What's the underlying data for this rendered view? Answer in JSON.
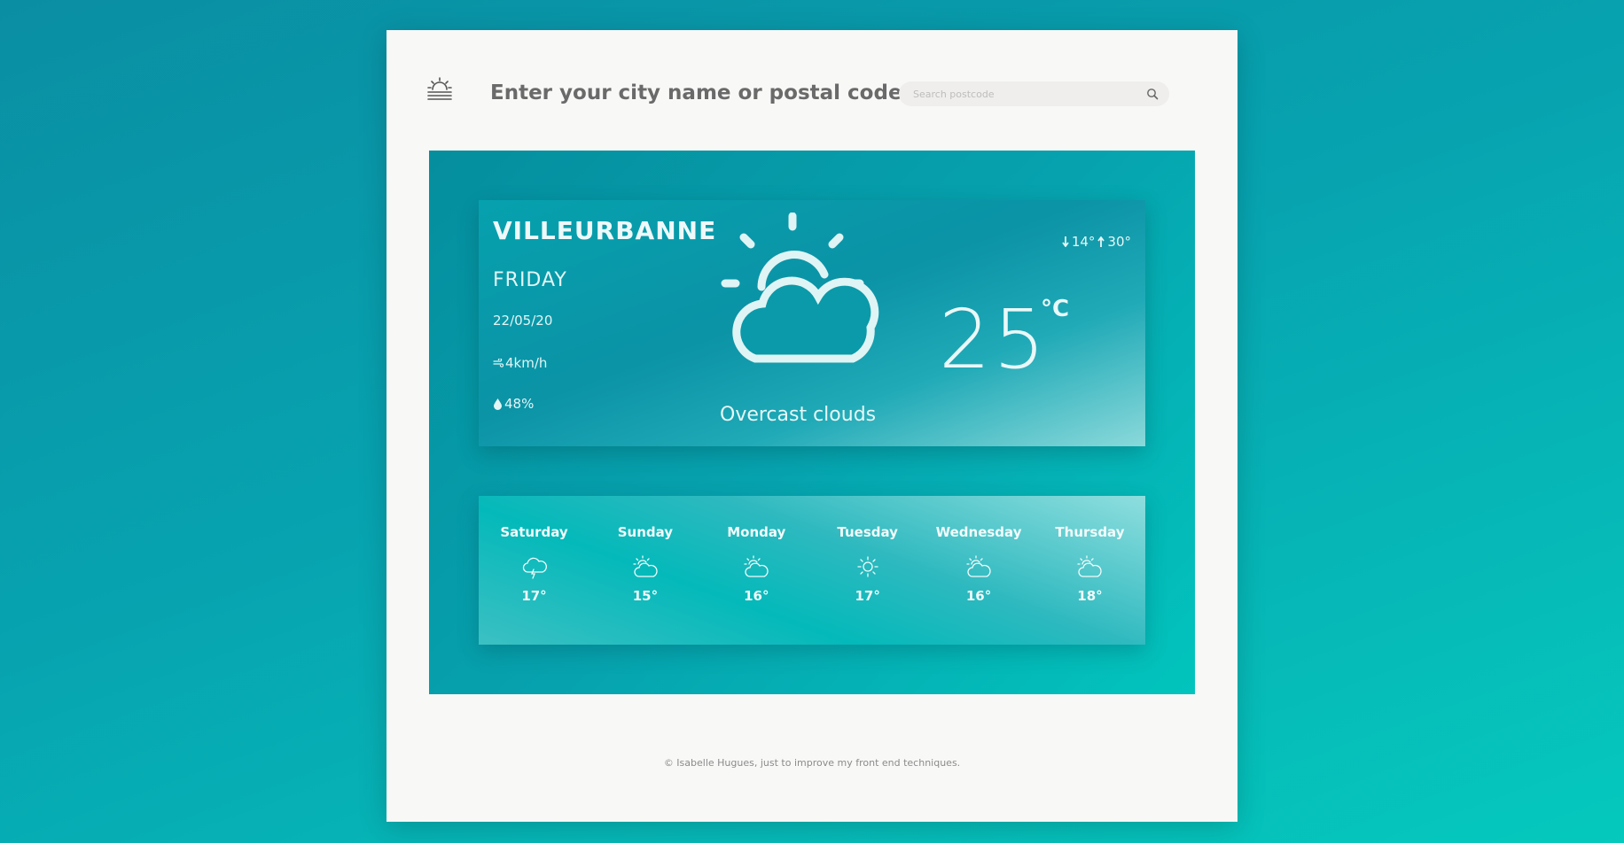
{
  "header": {
    "title": "Enter your city name or postal code",
    "search_placeholder": "Search postcode",
    "search_value": ""
  },
  "current": {
    "city": "VILLEURBANNE",
    "day": "FRIDAY",
    "date": "22/05/20",
    "wind": "4km/h",
    "humidity": "48%",
    "description": "Overcast clouds",
    "temperature": "25",
    "unit": "°C",
    "min": "14°",
    "max": "30°",
    "icon": "cloud-sun-icon"
  },
  "forecast": [
    {
      "day": "Saturday",
      "temp": "17°",
      "icon": "cloud-rain-icon"
    },
    {
      "day": "Sunday",
      "temp": "15°",
      "icon": "partly-cloudy-icon"
    },
    {
      "day": "Monday",
      "temp": "16°",
      "icon": "partly-cloudy-icon"
    },
    {
      "day": "Tuesday",
      "temp": "17°",
      "icon": "sun-icon"
    },
    {
      "day": "Wednesday",
      "temp": "16°",
      "icon": "partly-cloudy-icon"
    },
    {
      "day": "Thursday",
      "temp": "18°",
      "icon": "partly-cloudy-icon"
    }
  ],
  "footer": {
    "text": "© Isabelle Hugues, just to improve my front end techniques."
  },
  "colors": {
    "background_accent": "#05b8b8",
    "panel_text": "#eaf8f8",
    "page_bg": "#f8f8f7"
  }
}
